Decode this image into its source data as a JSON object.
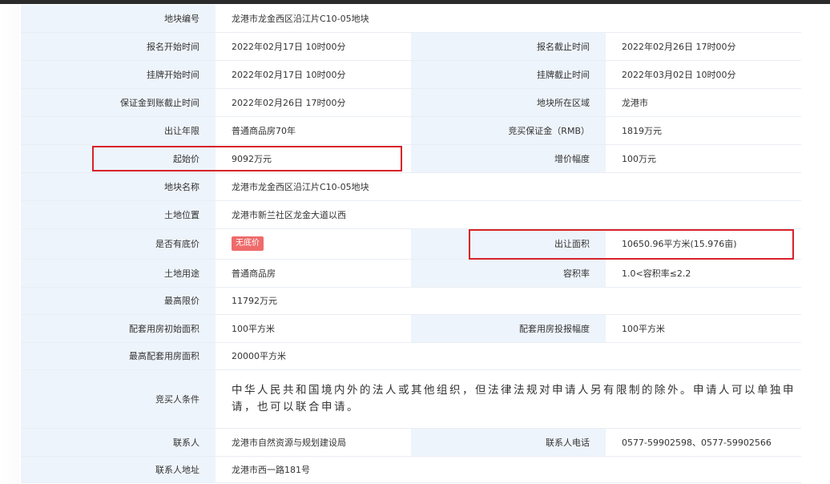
{
  "rows": {
    "plot_no": {
      "label": "地块编号",
      "value": "龙港市龙金西区沿江片C10-05地块"
    },
    "signup_start": {
      "label": "报名开始时间",
      "value": "2022年02月17日 10时00分"
    },
    "signup_end": {
      "label": "报名截止时间",
      "value": "2022年02月26日 17时00分"
    },
    "listing_start": {
      "label": "挂牌开始时间",
      "value": "2022年02月17日 10时00分"
    },
    "listing_end": {
      "label": "挂牌截止时间",
      "value": "2022年03月02日 10时00分"
    },
    "deposit_deadline": {
      "label": "保证金到账截止时间",
      "value": "2022年02月26日 17时00分"
    },
    "region": {
      "label": "地块所在区域",
      "value": "龙港市"
    },
    "term": {
      "label": "出让年限",
      "value": "普通商品房70年"
    },
    "deposit": {
      "label": "竞买保证金（RMB）",
      "value": "1819万元"
    },
    "start_price": {
      "label": "起始价",
      "value": "9092万元"
    },
    "increment": {
      "label": "增价幅度",
      "value": "100万元"
    },
    "plot_name": {
      "label": "地块名称",
      "value": "龙港市龙金西区沿江片C10-05地块"
    },
    "location": {
      "label": "土地位置",
      "value": "龙港市新兰社区龙金大道以西"
    },
    "reserve": {
      "label": "是否有底价",
      "value": "无底价"
    },
    "area": {
      "label": "出让面积",
      "value": "10650.96平方米(15.976亩)"
    },
    "usage": {
      "label": "土地用途",
      "value": "普通商品房"
    },
    "far": {
      "label": "容积率",
      "value": "1.0<容积率≤2.2"
    },
    "max_price": {
      "label": "最高限价",
      "value": "11792万元"
    },
    "support_init": {
      "label": "配套用房初始面积",
      "value": "100平方米"
    },
    "support_step": {
      "label": "配套用房投报幅度",
      "value": "100平方米"
    },
    "support_max": {
      "label": "最高配套用房面积",
      "value": "20000平方米"
    },
    "buyer_cond": {
      "label": "竞买人条件",
      "value": "中华人民共和国境内外的法人或其他组织，但法律法规对申请人另有限制的除外。申请人可以单独申请，也可以联合申请。"
    },
    "contact": {
      "label": "联系人",
      "value": "龙港市自然资源与规划建设局"
    },
    "phone": {
      "label": "联系人电话",
      "value": "0577-59902598、0577-59902566"
    },
    "address": {
      "label": "联系人地址",
      "value": "龙港市西一路181号"
    }
  },
  "colors": {
    "label_bg": "#eef4fb",
    "highlight": "#d9222a",
    "badge": "#ef6b6b"
  }
}
